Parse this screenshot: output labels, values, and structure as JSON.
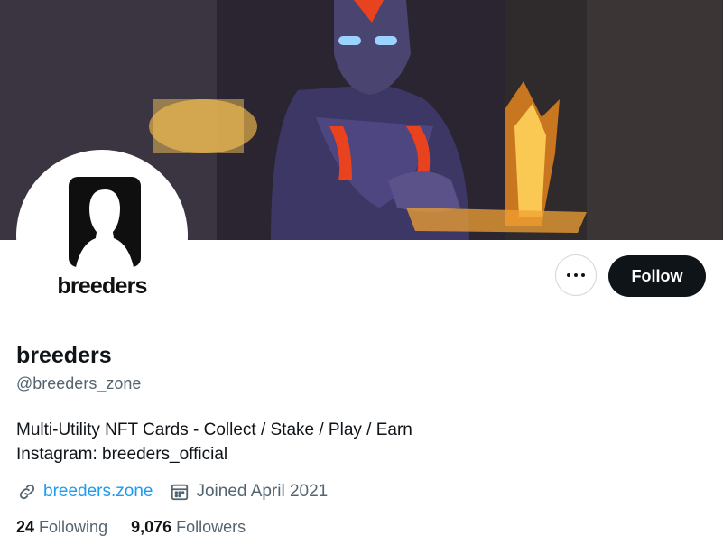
{
  "profile": {
    "display_name": "breeders",
    "handle": "@breeders_zone",
    "avatar_wordmark": "breeders",
    "bio_line1": "Multi-Utility NFT Cards - Collect / Stake / Play / Earn",
    "bio_line2": "Instagram: breeders_official",
    "website": "breeders.zone",
    "joined": "Joined April 2021",
    "following_count": "24",
    "following_label": "Following",
    "followers_count": "9,076",
    "followers_label": "Followers"
  },
  "actions": {
    "follow_label": "Follow",
    "more_icon": "more-horizontal-icon"
  },
  "colors": {
    "accent": "#1d9bf0",
    "text_primary": "#0f1419",
    "text_secondary": "#536471",
    "button_dark": "#0f1419"
  }
}
